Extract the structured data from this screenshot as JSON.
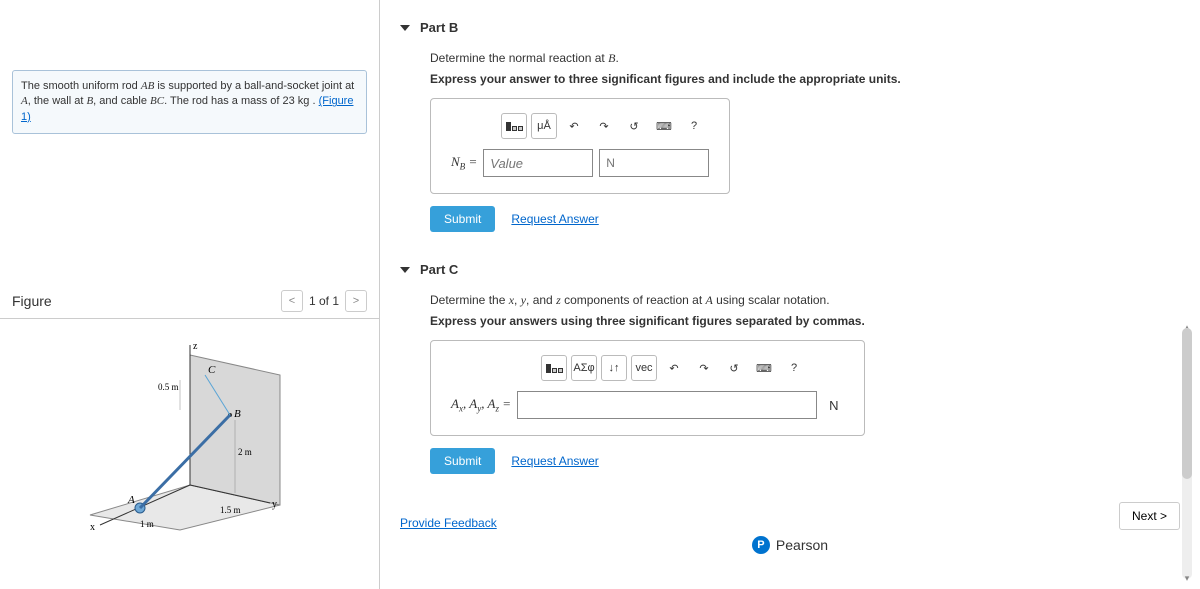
{
  "problem": {
    "text_before": "The smooth uniform rod ",
    "rod_label": "AB",
    "text_mid1": " is supported by a ball-and-socket joint at ",
    "point_a": "A",
    "text_mid2": ", the wall at ",
    "point_b": "B",
    "text_mid3": ", and cable ",
    "cable": "BC",
    "text_mid4": ". The rod has a mass of 23  kg",
    "text_end": " .",
    "figure_link": "(Figure 1)"
  },
  "figure": {
    "title": "Figure",
    "counter": "1 of 1",
    "labels": {
      "A": "A",
      "B": "B",
      "C": "C",
      "x": "x",
      "y": "y",
      "z": "z"
    },
    "dims": {
      "d1": "0.5 m",
      "d2": "2 m",
      "d3": "1 m",
      "d4": "1.5 m"
    }
  },
  "partB": {
    "title": "Part B",
    "prompt_before": "Determine the normal reaction at ",
    "prompt_point": "B",
    "prompt_after": ".",
    "instructions": "Express your answer to three significant figures and include the appropriate units.",
    "var_label": "N",
    "var_sub": "B",
    "equals": " = ",
    "value_placeholder": "Value",
    "units_placeholder": "N",
    "submit": "Submit",
    "request": "Request Answer",
    "tools": {
      "units": "μÅ",
      "undo": "↶",
      "redo": "↷",
      "reset": "↺",
      "kbd": "⌨",
      "help": "?"
    }
  },
  "partC": {
    "title": "Part C",
    "prompt": "Determine the x, y, and z components of reaction at A using scalar notation.",
    "instructions": "Express your answers using three significant figures separated by commas.",
    "var_label": "Aₓ, Aᵧ, A_z",
    "equals": " = ",
    "units_static": "N",
    "submit": "Submit",
    "request": "Request Answer",
    "tools": {
      "sym": "ΑΣφ",
      "updown": "↓↑",
      "vec": "vec",
      "undo": "↶",
      "redo": "↷",
      "reset": "↺",
      "kbd": "⌨",
      "help": "?"
    }
  },
  "feedback": "Provide Feedback",
  "next": "Next >",
  "brand": "Pearson"
}
